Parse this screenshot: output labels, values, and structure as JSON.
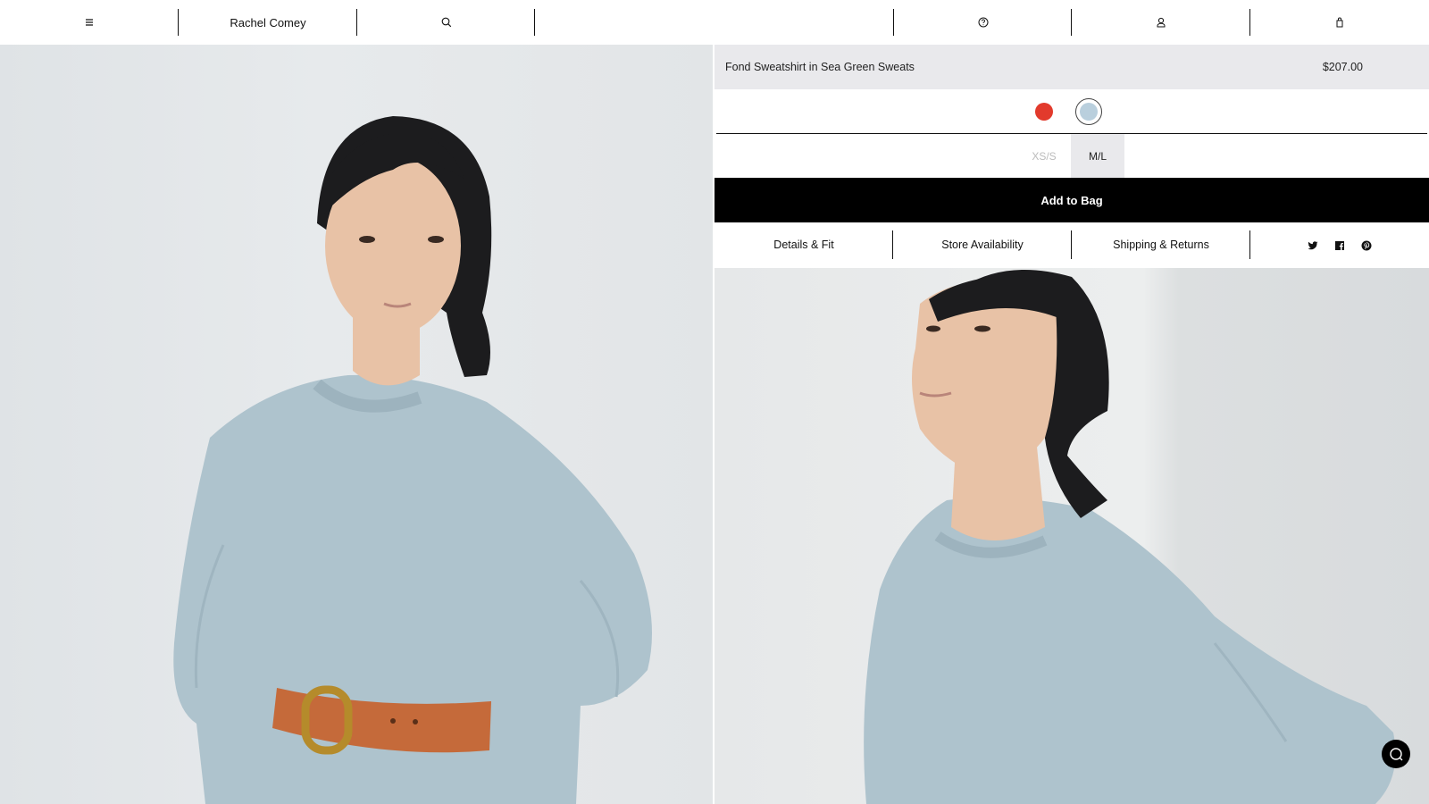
{
  "header": {
    "brand": "Rachel Comey",
    "icons": [
      "menu-icon",
      "search-icon",
      "help-icon",
      "account-icon",
      "bag-icon"
    ]
  },
  "product": {
    "title": "Fond Sweatshirt in Sea Green Sweats",
    "price": "$207.00",
    "colors": [
      {
        "name": "red",
        "hex": "#e23a2c",
        "selected": false
      },
      {
        "name": "sea green",
        "hex": "#b9cfdd",
        "selected": true
      }
    ],
    "sizes": [
      {
        "label": "XS/S",
        "available": false,
        "selected": false
      },
      {
        "label": "M/L",
        "available": true,
        "selected": true
      }
    ],
    "add_to_bag": "Add to Bag",
    "tabs": [
      "Details & Fit",
      "Store Availability",
      "Shipping & Returns"
    ],
    "social": [
      "twitter-icon",
      "facebook-icon",
      "pinterest-icon"
    ]
  },
  "colors": {
    "sweatshirt": "#aec3cd",
    "belt": "#c56a3a",
    "buckle": "#b58b2b",
    "hair": "#1c1c1e",
    "skin": "#e8c2a6"
  }
}
